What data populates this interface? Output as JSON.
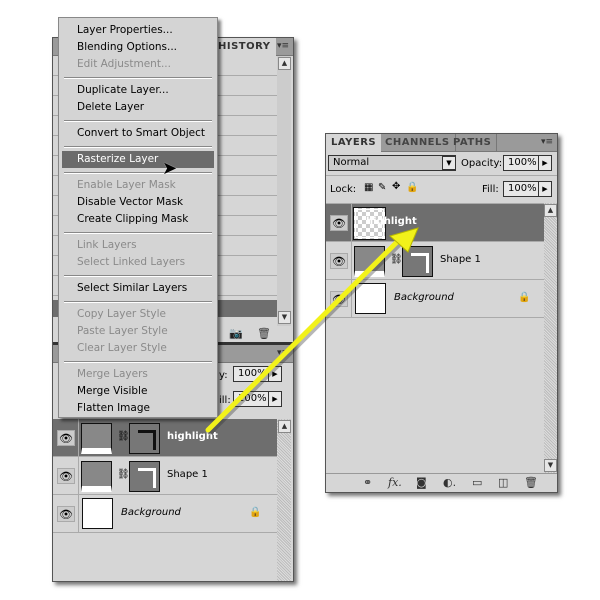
{
  "left_panel": {
    "history_tab": "HISTORY",
    "opacity_label": "y:",
    "opacity_value": "100%",
    "fill_label": "ill:",
    "fill_value": "100%",
    "layers": [
      {
        "name": "highlight",
        "selected": true
      },
      {
        "name": "Shape 1",
        "selected": false
      },
      {
        "name": "Background",
        "selected": false
      }
    ]
  },
  "context_menu": {
    "items": [
      {
        "label": "Layer Properties...",
        "enabled": true
      },
      {
        "label": "Blending Options...",
        "enabled": true
      },
      {
        "label": "Edit Adjustment...",
        "enabled": false
      },
      {
        "separator": true
      },
      {
        "label": "Duplicate Layer...",
        "enabled": true
      },
      {
        "label": "Delete Layer",
        "enabled": true
      },
      {
        "separator": true
      },
      {
        "label": "Convert to Smart Object",
        "enabled": true
      },
      {
        "separator": true
      },
      {
        "label": "Rasterize Layer",
        "enabled": true,
        "highlighted": true
      },
      {
        "separator": true
      },
      {
        "label": "Enable Layer Mask",
        "enabled": false
      },
      {
        "label": "Disable Vector Mask",
        "enabled": true
      },
      {
        "label": "Create Clipping Mask",
        "enabled": true
      },
      {
        "separator": true
      },
      {
        "label": "Link Layers",
        "enabled": false
      },
      {
        "label": "Select Linked Layers",
        "enabled": false
      },
      {
        "separator": true
      },
      {
        "label": "Select Similar Layers",
        "enabled": true
      },
      {
        "separator": true
      },
      {
        "label": "Copy Layer Style",
        "enabled": false
      },
      {
        "label": "Paste Layer Style",
        "enabled": false
      },
      {
        "label": "Clear Layer Style",
        "enabled": false
      },
      {
        "separator": true
      },
      {
        "label": "Merge Layers",
        "enabled": false
      },
      {
        "label": "Merge Visible",
        "enabled": true
      },
      {
        "label": "Flatten Image",
        "enabled": true
      }
    ]
  },
  "right_panel": {
    "tabs": [
      "LAYERS",
      "CHANNELS",
      "PATHS"
    ],
    "blend_mode": "Normal",
    "opacity_label": "Opacity:",
    "opacity_value": "100%",
    "lock_label": "Lock:",
    "fill_label": "Fill:",
    "fill_value": "100%",
    "layers": [
      {
        "name": "highlight",
        "selected": true
      },
      {
        "name": "Shape 1",
        "selected": false
      },
      {
        "name": "Background",
        "selected": false
      }
    ]
  },
  "colors": {
    "arrow": "#f2f21a",
    "selected_row": "#6e6e6e",
    "highlight_menu": "#6b6b6b"
  }
}
